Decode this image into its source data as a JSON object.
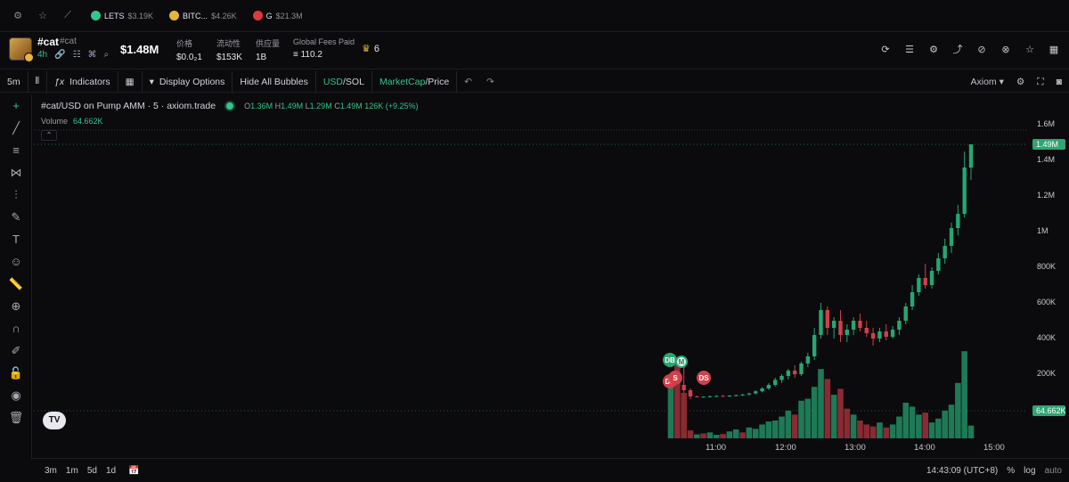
{
  "topbar": {
    "tickers": [
      {
        "name": "LETS",
        "value": "$3.19K",
        "color": "#35c48a"
      },
      {
        "name": "BITC...",
        "value": "$4.26K",
        "color": "#e8b43a"
      },
      {
        "name": "G",
        "value": "$21.3M",
        "color": "#e03a3a"
      }
    ]
  },
  "token": {
    "name": "#cat",
    "sub": "#cat",
    "age": "4h",
    "market_cap": "$1.48M",
    "stats": [
      {
        "label": "价格",
        "value": "$0.0₂1"
      },
      {
        "label": "流动性",
        "value": "$153K"
      },
      {
        "label": "供应量",
        "value": "1B"
      },
      {
        "label": "Global Fees Paid",
        "value": "≡ 110.2"
      }
    ],
    "holders": "6"
  },
  "toolbar": {
    "interval": "5m",
    "indicators": "Indicators",
    "display_options": "Display Options",
    "hide_bubbles": "Hide All Bubbles",
    "usd": "USD",
    "sol": "/SOL",
    "marketcap": "MarketCap",
    "price": "/Price",
    "provider": "Axiom"
  },
  "legend": {
    "title": "#cat/USD on Pump AMM · 5 · axiom.trade",
    "o": "1.36M",
    "h": "1.49M",
    "l": "1.29M",
    "c": "1.49M",
    "change": "126K (+9.25%)",
    "volume_label": "Volume",
    "volume_value": "64.662K"
  },
  "chart_data": {
    "type": "candlestick",
    "y_ticks": [
      "1.6M",
      "1.4M",
      "1.2M",
      "1M",
      "800K",
      "600K",
      "400K",
      "200K"
    ],
    "y_tick_values": [
      1600000,
      1400000,
      1200000,
      1000000,
      800000,
      600000,
      400000,
      200000
    ],
    "x_ticks": [
      "11:00",
      "12:00",
      "13:00",
      "14:00",
      "15:00"
    ],
    "last_price_label": "1.49M",
    "last_price": 1490000,
    "volume_label": "64.662K",
    "volume": 64662,
    "markers": [
      "DB",
      "M",
      "DS",
      "S",
      "DS"
    ],
    "candles": [
      {
        "o": 120000,
        "h": 210000,
        "l": 100000,
        "c": 170000
      },
      {
        "o": 170000,
        "h": 240000,
        "l": 90000,
        "c": 140000
      },
      {
        "o": 140000,
        "h": 260000,
        "l": 80000,
        "c": 110000
      },
      {
        "o": 110000,
        "h": 120000,
        "l": 60000,
        "c": 75000
      },
      {
        "o": 75000,
        "h": 80000,
        "l": 70000,
        "c": 72000
      },
      {
        "o": 72000,
        "h": 76000,
        "l": 68000,
        "c": 74000
      },
      {
        "o": 74000,
        "h": 80000,
        "l": 70000,
        "c": 76000
      },
      {
        "o": 76000,
        "h": 82000,
        "l": 72000,
        "c": 78000
      },
      {
        "o": 78000,
        "h": 84000,
        "l": 74000,
        "c": 76000
      },
      {
        "o": 76000,
        "h": 82000,
        "l": 72000,
        "c": 80000
      },
      {
        "o": 80000,
        "h": 86000,
        "l": 76000,
        "c": 82000
      },
      {
        "o": 82000,
        "h": 90000,
        "l": 78000,
        "c": 86000
      },
      {
        "o": 86000,
        "h": 96000,
        "l": 82000,
        "c": 92000
      },
      {
        "o": 92000,
        "h": 110000,
        "l": 88000,
        "c": 104000
      },
      {
        "o": 104000,
        "h": 128000,
        "l": 98000,
        "c": 120000
      },
      {
        "o": 120000,
        "h": 150000,
        "l": 112000,
        "c": 140000
      },
      {
        "o": 140000,
        "h": 180000,
        "l": 130000,
        "c": 168000
      },
      {
        "o": 168000,
        "h": 200000,
        "l": 150000,
        "c": 190000
      },
      {
        "o": 190000,
        "h": 230000,
        "l": 170000,
        "c": 220000
      },
      {
        "o": 220000,
        "h": 250000,
        "l": 180000,
        "c": 200000
      },
      {
        "o": 200000,
        "h": 270000,
        "l": 190000,
        "c": 260000
      },
      {
        "o": 260000,
        "h": 320000,
        "l": 240000,
        "c": 300000
      },
      {
        "o": 300000,
        "h": 460000,
        "l": 280000,
        "c": 420000
      },
      {
        "o": 420000,
        "h": 600000,
        "l": 400000,
        "c": 560000
      },
      {
        "o": 560000,
        "h": 580000,
        "l": 420000,
        "c": 460000
      },
      {
        "o": 460000,
        "h": 520000,
        "l": 400000,
        "c": 500000
      },
      {
        "o": 500000,
        "h": 560000,
        "l": 380000,
        "c": 420000
      },
      {
        "o": 420000,
        "h": 480000,
        "l": 380000,
        "c": 450000
      },
      {
        "o": 450000,
        "h": 520000,
        "l": 420000,
        "c": 500000
      },
      {
        "o": 500000,
        "h": 540000,
        "l": 440000,
        "c": 460000
      },
      {
        "o": 460000,
        "h": 500000,
        "l": 410000,
        "c": 430000
      },
      {
        "o": 430000,
        "h": 460000,
        "l": 360000,
        "c": 400000
      },
      {
        "o": 400000,
        "h": 460000,
        "l": 380000,
        "c": 440000
      },
      {
        "o": 440000,
        "h": 480000,
        "l": 390000,
        "c": 410000
      },
      {
        "o": 410000,
        "h": 470000,
        "l": 400000,
        "c": 450000
      },
      {
        "o": 450000,
        "h": 520000,
        "l": 420000,
        "c": 500000
      },
      {
        "o": 500000,
        "h": 600000,
        "l": 480000,
        "c": 580000
      },
      {
        "o": 580000,
        "h": 700000,
        "l": 560000,
        "c": 660000
      },
      {
        "o": 660000,
        "h": 760000,
        "l": 640000,
        "c": 740000
      },
      {
        "o": 740000,
        "h": 820000,
        "l": 680000,
        "c": 700000
      },
      {
        "o": 700000,
        "h": 800000,
        "l": 680000,
        "c": 780000
      },
      {
        "o": 780000,
        "h": 880000,
        "l": 760000,
        "c": 850000
      },
      {
        "o": 850000,
        "h": 960000,
        "l": 820000,
        "c": 920000
      },
      {
        "o": 920000,
        "h": 1050000,
        "l": 880000,
        "c": 1020000
      },
      {
        "o": 1020000,
        "h": 1150000,
        "l": 980000,
        "c": 1100000
      },
      {
        "o": 1100000,
        "h": 1450000,
        "l": 1080000,
        "c": 1360000
      },
      {
        "o": 1360000,
        "h": 1490000,
        "l": 1290000,
        "c": 1490000
      }
    ],
    "volumes": [
      {
        "v": 320000,
        "up": true
      },
      {
        "v": 400000,
        "up": false
      },
      {
        "v": 230000,
        "up": false
      },
      {
        "v": 40000,
        "up": false
      },
      {
        "v": 20000,
        "up": true
      },
      {
        "v": 25000,
        "up": false
      },
      {
        "v": 30000,
        "up": true
      },
      {
        "v": 18000,
        "up": true
      },
      {
        "v": 22000,
        "up": false
      },
      {
        "v": 35000,
        "up": true
      },
      {
        "v": 45000,
        "up": true
      },
      {
        "v": 30000,
        "up": false
      },
      {
        "v": 55000,
        "up": true
      },
      {
        "v": 48000,
        "up": true
      },
      {
        "v": 70000,
        "up": true
      },
      {
        "v": 85000,
        "up": true
      },
      {
        "v": 90000,
        "up": true
      },
      {
        "v": 110000,
        "up": true
      },
      {
        "v": 140000,
        "up": true
      },
      {
        "v": 120000,
        "up": false
      },
      {
        "v": 190000,
        "up": true
      },
      {
        "v": 200000,
        "up": true
      },
      {
        "v": 260000,
        "up": true
      },
      {
        "v": 350000,
        "up": true
      },
      {
        "v": 300000,
        "up": false
      },
      {
        "v": 220000,
        "up": true
      },
      {
        "v": 250000,
        "up": false
      },
      {
        "v": 150000,
        "up": false
      },
      {
        "v": 120000,
        "up": true
      },
      {
        "v": 90000,
        "up": false
      },
      {
        "v": 70000,
        "up": false
      },
      {
        "v": 60000,
        "up": false
      },
      {
        "v": 80000,
        "up": true
      },
      {
        "v": 55000,
        "up": false
      },
      {
        "v": 70000,
        "up": true
      },
      {
        "v": 110000,
        "up": true
      },
      {
        "v": 180000,
        "up": true
      },
      {
        "v": 160000,
        "up": true
      },
      {
        "v": 120000,
        "up": true
      },
      {
        "v": 130000,
        "up": false
      },
      {
        "v": 80000,
        "up": true
      },
      {
        "v": 100000,
        "up": true
      },
      {
        "v": 140000,
        "up": true
      },
      {
        "v": 170000,
        "up": true
      },
      {
        "v": 280000,
        "up": true
      },
      {
        "v": 440000,
        "up": true
      },
      {
        "v": 64662,
        "up": true
      }
    ]
  },
  "bottombar": {
    "ranges": [
      "3m",
      "1m",
      "5d",
      "1d"
    ],
    "time": "14:43:09 (UTC+8)",
    "pct": "%",
    "log": "log",
    "auto": "auto"
  },
  "colors": {
    "up": "#26a672",
    "down": "#d0404a",
    "accent": "#35c48a"
  }
}
